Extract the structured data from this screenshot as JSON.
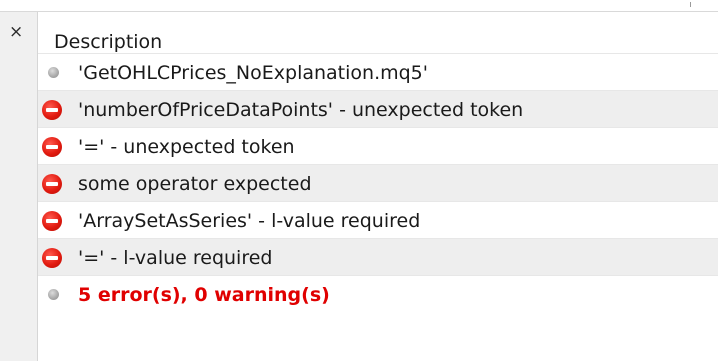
{
  "panel": {
    "close_glyph": "×",
    "column_header": "Description"
  },
  "rows": [
    {
      "type": "info",
      "icon": "info-dot-icon",
      "text": "'GetOHLCPrices_NoExplanation.mq5'"
    },
    {
      "type": "error",
      "icon": "error-icon",
      "text": "'numberOfPriceDataPoints' - unexpected token"
    },
    {
      "type": "error",
      "icon": "error-icon",
      "text": "'=' - unexpected token"
    },
    {
      "type": "error",
      "icon": "error-icon",
      "text": "some operator expected"
    },
    {
      "type": "error",
      "icon": "error-icon",
      "text": "'ArraySetAsSeries' - l-value required"
    },
    {
      "type": "error",
      "icon": "error-icon",
      "text": "'=' - l-value required"
    },
    {
      "type": "info",
      "icon": "info-dot-icon",
      "text": "5 error(s), 0 warning(s)"
    }
  ],
  "colors": {
    "error_red": "#e21b10",
    "summary_text": "#e00000",
    "alt_row": "#eeeeee"
  }
}
